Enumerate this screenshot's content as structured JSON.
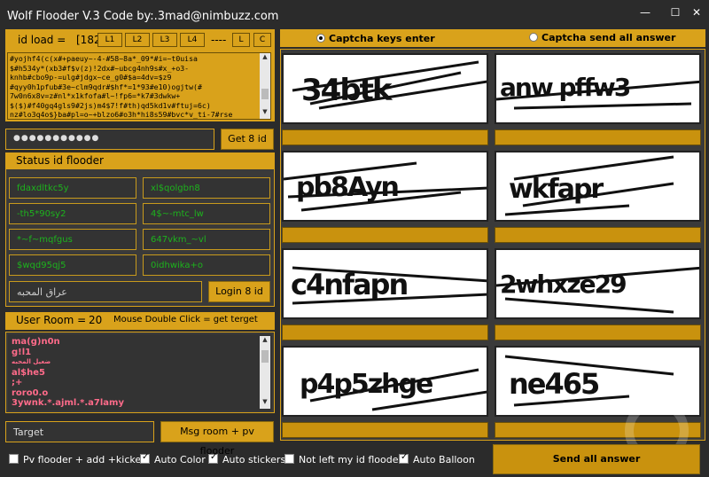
{
  "window": {
    "title": "Wolf Flooder V.3 Code by:.3mad@nimbuzz.com",
    "minimize": "—",
    "maximize": "☐",
    "close": "✕"
  },
  "id_load": {
    "label": "id load =",
    "count": "[182",
    "buttons": [
      "L1",
      "L2",
      "L3",
      "L4"
    ],
    "separator": "----",
    "l_button": "L",
    "c_button": "C"
  },
  "id_list_text": "#yojhf4(c(x#+paeuy~-4-#58~8a*_09*#i=~t0uisa\n$#h534y*(xb3#f$v(z)!2dx#~ubcg4nh9s#x_+o3-\nknhb#cbo9p-=ulg#jdgx~ce_g0#$a=4dv=$z9\n#qyy0h1pfub#3e~clm9qdr#$hf*=1*93#e10)ogjtw(#\n7w0n6x8v=z#nl*x1kfofa#l~!fp6=*k7#3dwkw+\n$($)#f40gq4gls9#2js)m4$7!f#th)qd5kd1v#ftuj=6c)\nnz#lo3q4o$}ba#pl=o~+blzo6#o3h*hi8s59#bvc*v_ti-7#rse",
  "password": {
    "masked": "●●●●●●●●●●●",
    "get_button": "Get 8 id"
  },
  "status": {
    "header": "Status id flooder",
    "fields": [
      "fdaxdltkc5y",
      "xl$qolgbn8",
      "-th5*90sy2",
      "4$~-mtc_lw",
      "*~f~mqfgus",
      "647vkm_~vl",
      "$wqd95qj5",
      "0idhwika+o"
    ],
    "room_name": "عراق المحبه",
    "login_button": "Login 8 id"
  },
  "user_room": {
    "label": "User Room =",
    "count": "20",
    "hint": "Mouse Double Click = get terget",
    "users": [
      "ma(g)n0n",
      "g!l1",
      "ضعيل المحبه",
      "al$he5",
      ";+",
      "roro0.o",
      "3ywnk.*.ajml.*.a7lamy"
    ]
  },
  "bottom": {
    "target_placeholder": "Target",
    "msg_button": "Msg room + pv flooder",
    "send_all": "Send all answer"
  },
  "captcha": {
    "radio_keys": "Captcha keys enter",
    "radio_send": "Captcha send all answer",
    "images": [
      "34btk",
      "anw pffw3",
      "pb8Ayn",
      "wkfapr",
      "c4nfapn",
      "2whxze29",
      "p4p5zhge",
      "ne465"
    ]
  },
  "checkboxes": [
    {
      "label": "Pv flooder + add +kicked",
      "checked": false
    },
    {
      "label": "Auto Color",
      "checked": true
    },
    {
      "label": "Auto stickers",
      "checked": true
    },
    {
      "label": "Not left my id flooder",
      "checked": false
    },
    {
      "label": "Auto Balloon",
      "checked": true
    }
  ],
  "colors": {
    "accent": "#d9a21b",
    "background": "#2b2b2b",
    "status_text": "#1db31d",
    "user_text": "#ff6b8a"
  }
}
